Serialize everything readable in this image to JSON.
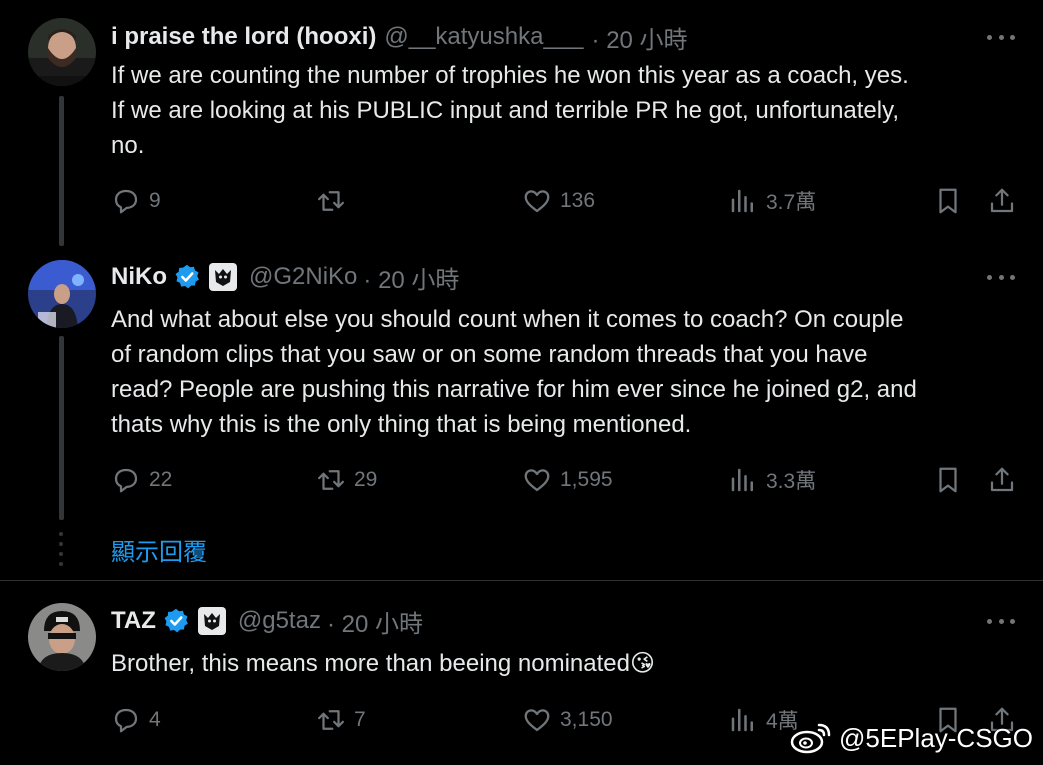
{
  "tweets": [
    {
      "name": "i praise the lord (hooxi)",
      "handle": "@__katyushka___",
      "time": "· 20 小時",
      "text_lines": [
        "If we are counting the number of trophies he won this year as a coach, yes.",
        "If we are looking at his PUBLIC input and terrible PR he got, unfortunately,",
        "no."
      ],
      "replies": "9",
      "retweets": "",
      "likes": "136",
      "views": "3.7萬"
    },
    {
      "name": "NiKo",
      "handle": "@G2NiKo",
      "time": "· 20 小時",
      "text_lines": [
        "And what about else you should count when it comes to coach? On couple",
        "of random clips that you saw or on some random threads that you have",
        "read? People are pushing this narrative for him ever since he joined g2, and",
        "thats why this is the only thing that is being mentioned."
      ],
      "replies": "22",
      "retweets": "29",
      "likes": "1,595",
      "views": "3.3萬"
    },
    {
      "name": "TAZ",
      "handle": "@g5taz",
      "time": "· 20 小時",
      "text_lines": [
        "Brother, this means more than beeing nominated😘"
      ],
      "replies": "4",
      "retweets": "7",
      "likes": "3,150",
      "views": "4萬"
    }
  ],
  "show_replies": "顯示回覆",
  "watermark": "@5EPlay-CSGO",
  "colors": {
    "background": "#000000",
    "text": "#e7e9ea",
    "muted": "#71767b",
    "accent": "#1d9bf0",
    "verified": "#1d9bf0"
  },
  "icons": [
    "reply-icon",
    "retweet-icon",
    "like-icon",
    "views-icon",
    "bookmark-icon",
    "share-icon",
    "more-icon",
    "verified-icon",
    "g2-affiliate-icon",
    "weibo-icon"
  ]
}
